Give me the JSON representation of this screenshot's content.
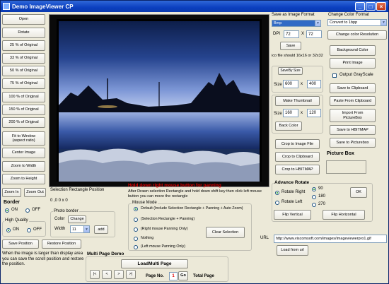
{
  "window": {
    "title": "Demo ImageViewer CP"
  },
  "left_buttons": [
    "Open",
    "Rotate",
    "25 % of Original",
    "33 % of Original",
    "50 % of Original",
    "75 % of Original",
    "100 % of Original",
    "150 % of Original",
    "200 % of Original",
    "Fit to Window\n(aspect ratio)",
    "Center Image",
    "Zoom to Width",
    "Zoom to Height"
  ],
  "zoom": {
    "zoom_in": "Zoom In",
    "zoom_out": "Zoom Out"
  },
  "selection": {
    "label": "Selection Rectangle Position",
    "value": "0 ,0 0 x 0"
  },
  "border": {
    "title": "Border",
    "on": "ON",
    "off": "OFF"
  },
  "photo_border": {
    "title": "Photo border",
    "color_label": "Color",
    "change": "Change",
    "width_label": "Width",
    "width_value": "11",
    "add": "add"
  },
  "high_quality": {
    "title": "High Quality",
    "on": "ON",
    "off": "OFF"
  },
  "position": {
    "save": "Save Position",
    "restore": "Restore Position",
    "note": "When the image is larger than display area you can save the scroll position and restore the position."
  },
  "pan": {
    "title": "Hold down right mouse button for panning",
    "note": "After Drawn selection Rectangle and hold down shift key then click left mouse button you can move the rectangle"
  },
  "mouse_mode": {
    "title": "Mouse Mode",
    "options": [
      "Default (Include Selection Rectangle + Panning + Auto Zoom)",
      "(Selection Rectangle + Panning)",
      "(Right mouse Panning Only)",
      "Nothing",
      "(Left mouse Panning Only)"
    ],
    "clear": "Clear Selection"
  },
  "multipage": {
    "title": "Multi Page Demo",
    "load": "LoadMulti Page",
    "nav": [
      "|<",
      "<",
      ">",
      ">|"
    ],
    "page_label": "Page No.",
    "page_value": "1",
    "go": "Go",
    "total": "Total Page"
  },
  "save_format": {
    "title": "Save as Image Format",
    "value": "Bmp",
    "dpi_label": "DPI",
    "dpi_x": "72",
    "dpi_y": "72",
    "x": "X",
    "save": "Save",
    "icon_note": "ico file should 16x16 or 32x32"
  },
  "save_by_size": {
    "title": "SaveBy Size",
    "size_label": "Size",
    "w": "600",
    "x": "x",
    "h": "400"
  },
  "thumbnail": {
    "title": "Make Thumbnail",
    "size_label": "Size",
    "w": "160",
    "x": "x",
    "h": "120",
    "back_color": "Back Color"
  },
  "crop": [
    "Crop to Image File",
    "Crop to Clipboard",
    "Crop to HBITMAP"
  ],
  "color_format": {
    "title": "Change Color Format",
    "value": "Convert to 1bpp",
    "change_res": "Change color Resolution"
  },
  "right_buttons": [
    "Background Color",
    "Print Image"
  ],
  "grayscale": {
    "label": "Output GrayScale"
  },
  "right_buttons2": [
    "Save to Clipboard",
    "Paste From Clipboard",
    "Import From PictureBox",
    "Save to HBITMAP",
    "Save to Picturebox"
  ],
  "picture_box": {
    "title": "Picture Box"
  },
  "advance_rotate": {
    "title": "Advance Rotate",
    "rotate_right": "Rotate Right",
    "rotate_left": "Rotate Left",
    "deg": [
      "90",
      "180",
      "270"
    ],
    "ok": "OK",
    "flip_v": "Flip Vertical",
    "flip_h": "Flip Horizontal"
  },
  "url": {
    "label": "URL",
    "value": "http://www.viscomsoft.com/images/imageviewerpro1.gif",
    "load": "Load from url"
  }
}
